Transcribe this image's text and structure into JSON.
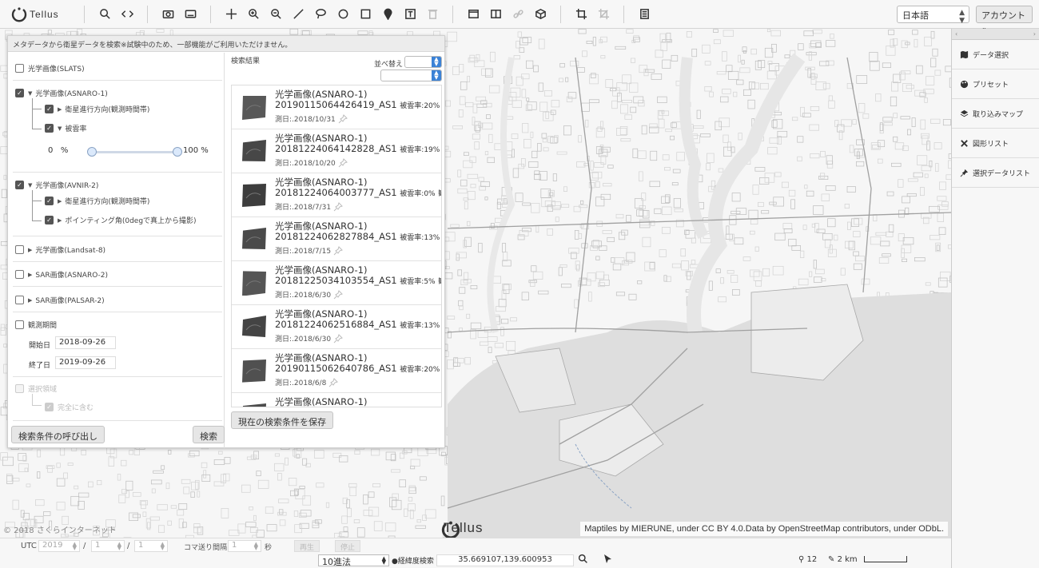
{
  "app": {
    "logo_text": "Tellus"
  },
  "toolbar": {
    "language": "日本語",
    "account": "アカウント"
  },
  "notice": "メタデータから衛星データを検索※試験中のため、一部機能がご利用いただけません。",
  "filters": {
    "slats": "光学画像(SLATS)",
    "asnaro1": "光学画像(ASNARO-1)",
    "asnaro1_dir": "衛星進行方向(観測時間帯)",
    "asnaro1_cloud": "被雲率",
    "cloud_min": "0",
    "cloud_unit_min": "%",
    "cloud_max": "100",
    "cloud_unit_max": "%",
    "cloud_range_fraction": [
      0,
      1
    ],
    "avnir2": "光学画像(AVNIR-2)",
    "avnir2_dir": "衛星進行方向(観測時間帯)",
    "avnir2_point": "ポインティング角(0degで真上から撮影)",
    "landsat8": "光学画像(Landsat-8)",
    "sar_asnaro2": "SAR画像(ASNARO-2)",
    "sar_palsar2": "SAR画像(PALSAR-2)",
    "period": "観測期間",
    "start_label": "開始日",
    "start_value": "2018-09-26",
    "end_label": "終了日",
    "end_value": "2019-09-26",
    "area": "選択領域",
    "area_full": "完全に含む",
    "recall_button": "検索条件の呼び出し",
    "search_button": "検索"
  },
  "results": {
    "label": "検索結果",
    "sort_label": "並べ替え",
    "save_button": "現在の検索条件を保存",
    "cloud_prefix": "被雲率:",
    "view_suffix": "観",
    "items": [
      {
        "title": "光学画像(ASNARO-1)",
        "id": "20190115064426419_AS1",
        "cloud": "20%",
        "date": "測日:.2018/10/31"
      },
      {
        "title": "光学画像(ASNARO-1)",
        "id": "20181224064142828_AS1",
        "cloud": "19%",
        "date": "測日:.2018/10/20"
      },
      {
        "title": "光学画像(ASNARO-1)",
        "id": "20181224064003777_AS1",
        "cloud": "0%",
        "date": "測日:.2018/7/31"
      },
      {
        "title": "光学画像(ASNARO-1)",
        "id": "20181224062827884_AS1",
        "cloud": "13%",
        "date": "測日:.2018/7/15"
      },
      {
        "title": "光学画像(ASNARO-1)",
        "id": "20181225034103554_AS1",
        "cloud": "5%",
        "date": "測日:.2018/6/30"
      },
      {
        "title": "光学画像(ASNARO-1)",
        "id": "20181224062516884_AS1",
        "cloud": "13%",
        "date": "測日:.2018/6/30"
      },
      {
        "title": "光学画像(ASNARO-1)",
        "id": "20190115062640786_AS1",
        "cloud": "20%",
        "date": "測日:.2018/6/8"
      },
      {
        "title": "光学画像(ASNARO-1)",
        "id": "",
        "cloud": "",
        "date": ""
      }
    ]
  },
  "side": {
    "items": [
      "データ選択",
      "プリセット",
      "取り込みマップ",
      "図形リスト",
      "選択データリスト"
    ]
  },
  "map": {
    "attribution": "Maptiles by MIERUNE, under CC BY 4.0.Data by OpenStreetMap contributors, under ODbL.",
    "copyright": "© 2018 さくらインターネット",
    "logo_text": "Tellus"
  },
  "timebar": {
    "utc": "UTC",
    "year": "2019",
    "month": "1",
    "day": "1",
    "sep": "/",
    "interval_label": "コマ送り間隔",
    "interval_value": "1",
    "sec": "秒",
    "play": "再生",
    "stop": "停止"
  },
  "statusbar": {
    "format": "10進法",
    "coord_label": "経緯度検索",
    "coord_value": "35.669107,139.600953",
    "zoom": "12",
    "scale": "2 km"
  }
}
